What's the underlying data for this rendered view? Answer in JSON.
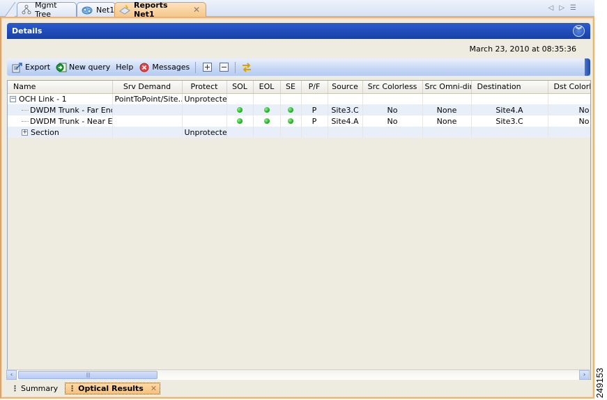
{
  "tabs": [
    {
      "label": "Mgmt Tree",
      "icon": "hierarchy-icon",
      "active": false
    },
    {
      "label": "Net1",
      "icon": "network-cloud-icon",
      "active": false
    },
    {
      "label": "Reports Net1",
      "icon": "report-icon",
      "active": true,
      "closable": true
    }
  ],
  "tab_nav": {
    "prev": "◁",
    "next": "▷",
    "menu": "☰"
  },
  "details": {
    "title": "Details",
    "collapse_icon": "double-chevron-down-icon"
  },
  "timestamp": "March 23, 2010 at 08:35:36",
  "toolbar": {
    "export": "Export",
    "new_query": "New query",
    "help": "Help",
    "messages": "Messages"
  },
  "table": {
    "columns": [
      "Name",
      "Srv Demand",
      "Protect",
      "SOL",
      "EOL",
      "SE",
      "P/F",
      "Source",
      "Src Colorless",
      "Src Omni-dir",
      "Destination",
      "Dst Colorle"
    ],
    "rows": [
      {
        "name": "OCH Link - 1",
        "expander": "−",
        "level": 0,
        "srv_demand": "PointToPoint/Site…",
        "protect": "Unprotected",
        "sol": "",
        "eol": "",
        "se": "",
        "pf": "",
        "source": "",
        "src_colorless": "",
        "src_omni": "",
        "destination": "",
        "dst_colorless": ""
      },
      {
        "name": "DWDM Trunk - Far End",
        "level": 1,
        "srv_demand": "",
        "protect": "",
        "sol": "green",
        "eol": "green",
        "se": "green",
        "pf": "P",
        "source": "Site3.C",
        "src_colorless": "No",
        "src_omni": "None",
        "destination": "Site4.A",
        "dst_colorless": "No"
      },
      {
        "name": "DWDM Trunk - Near End",
        "level": 1,
        "srv_demand": "",
        "protect": "",
        "sol": "green",
        "eol": "green",
        "se": "green",
        "pf": "P",
        "source": "Site4.A",
        "src_colorless": "No",
        "src_omni": "None",
        "destination": "Site3.C",
        "dst_colorless": "No"
      },
      {
        "name": "Section",
        "expander": "+",
        "level": 1,
        "srv_demand": "",
        "protect": "Unprotected",
        "sol": "",
        "eol": "",
        "se": "",
        "pf": "",
        "source": "",
        "src_colorless": "",
        "src_omni": "",
        "destination": "",
        "dst_colorless": ""
      }
    ]
  },
  "scrollbar": {
    "left": "‹",
    "right": "›",
    "grip": "||||"
  },
  "bottom_tabs": [
    {
      "label": "Summary",
      "active": false
    },
    {
      "label": "Optical Results",
      "active": true,
      "closable": true
    }
  ],
  "figure_id": "249153",
  "colors": {
    "accent_blue": "#1f4cb3",
    "active_tab_orange": "#f7c27c",
    "status_green": "#22b222"
  }
}
